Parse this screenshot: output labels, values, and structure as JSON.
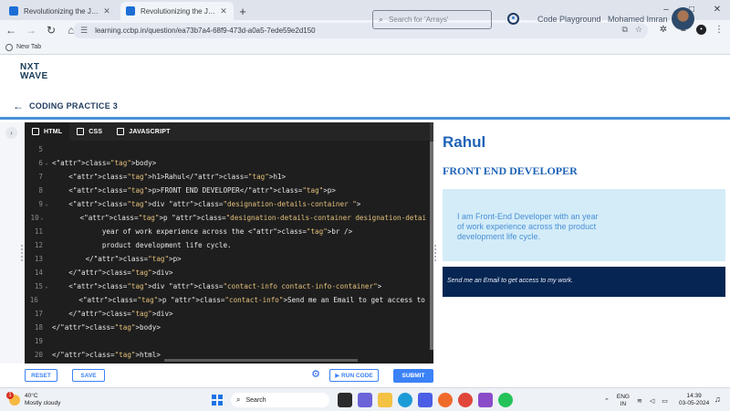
{
  "browser": {
    "tabs": [
      {
        "title": "Revolutionizing the Job Market",
        "active": false
      },
      {
        "title": "Revolutionizing the Job Market",
        "active": true
      }
    ],
    "new_tab_glyph": "+",
    "url": "learning.ccbp.in/question/ea73b7a4-68f9-473d-a0a5-7ede59e2d150",
    "bookmark": "New Tab",
    "window_controls": [
      "–",
      "□",
      "✕"
    ],
    "profile_initial": "•"
  },
  "header": {
    "logo_line1": "NXT",
    "logo_line2": "WAVE",
    "search_placeholder": "Search for 'Arrays'",
    "playground_label": "Code Playground",
    "user_name": "Mohamed Imran"
  },
  "practice": {
    "title": "CODING PRACTICE 3"
  },
  "editor": {
    "tabs": [
      {
        "label": "HTML",
        "active": true
      },
      {
        "label": "CSS",
        "active": false
      },
      {
        "label": "JAVASCRIPT",
        "active": false
      }
    ],
    "lines": [
      {
        "n": "5",
        "fold": "",
        "text": ""
      },
      {
        "n": "6",
        "fold": "⌄",
        "text": "<body>"
      },
      {
        "n": "7",
        "fold": "",
        "text": "    <h1>Rahul</h1>"
      },
      {
        "n": "8",
        "fold": "",
        "text": "    <p>FRONT END DEVELOPER</p>"
      },
      {
        "n": "9",
        "fold": "⌄",
        "text": "    <div class=\"designation-details-container \">"
      },
      {
        "n": "10",
        "fold": "⌄",
        "text": "        <p class=\"designation-details-container designation-details\"> I am Front-End Devel"
      },
      {
        "n": "11",
        "fold": "",
        "text": "            year of work experience across the <br />"
      },
      {
        "n": "12",
        "fold": "",
        "text": "            product development life cycle."
      },
      {
        "n": "13",
        "fold": "",
        "text": "        </p>"
      },
      {
        "n": "14",
        "fold": "",
        "text": "    </div>"
      },
      {
        "n": "15",
        "fold": "⌄",
        "text": "    <div class=\"contact-info contact-info-container\">"
      },
      {
        "n": "16",
        "fold": "",
        "text": "        <p class=\"contact-info\">Send me an Email to get access to my work.</p>"
      },
      {
        "n": "17",
        "fold": "",
        "text": "    </div>"
      },
      {
        "n": "18",
        "fold": "",
        "text": "</body>"
      },
      {
        "n": "19",
        "fold": "",
        "text": ""
      },
      {
        "n": "20",
        "fold": "",
        "text": "</html>"
      }
    ]
  },
  "actions": {
    "reset": "RESET",
    "save": "SAVE",
    "run": "▶ RUN CODE",
    "submit": "SUBMIT"
  },
  "preview": {
    "name": "Rahul",
    "role": "FRONT END DEVELOPER",
    "details": "I am Front-End Developer with an year of work experience across the product development life cycle.",
    "contact": "Send me an Email to get access to my work."
  },
  "taskbar": {
    "weather_temp": "40°C",
    "weather_desc": "Mostly cloudy",
    "weather_badge": "1",
    "search_label": "Search",
    "lang_line1": "ENG",
    "lang_line2": "IN",
    "time": "14:39",
    "date": "03-05-2024"
  },
  "colors": {
    "accent": "#3b82f6",
    "brand_dark": "#1e3a5f",
    "preview_heading": "#1e63b8",
    "details_bg": "#d3ecf8",
    "contact_bg": "#062552"
  }
}
